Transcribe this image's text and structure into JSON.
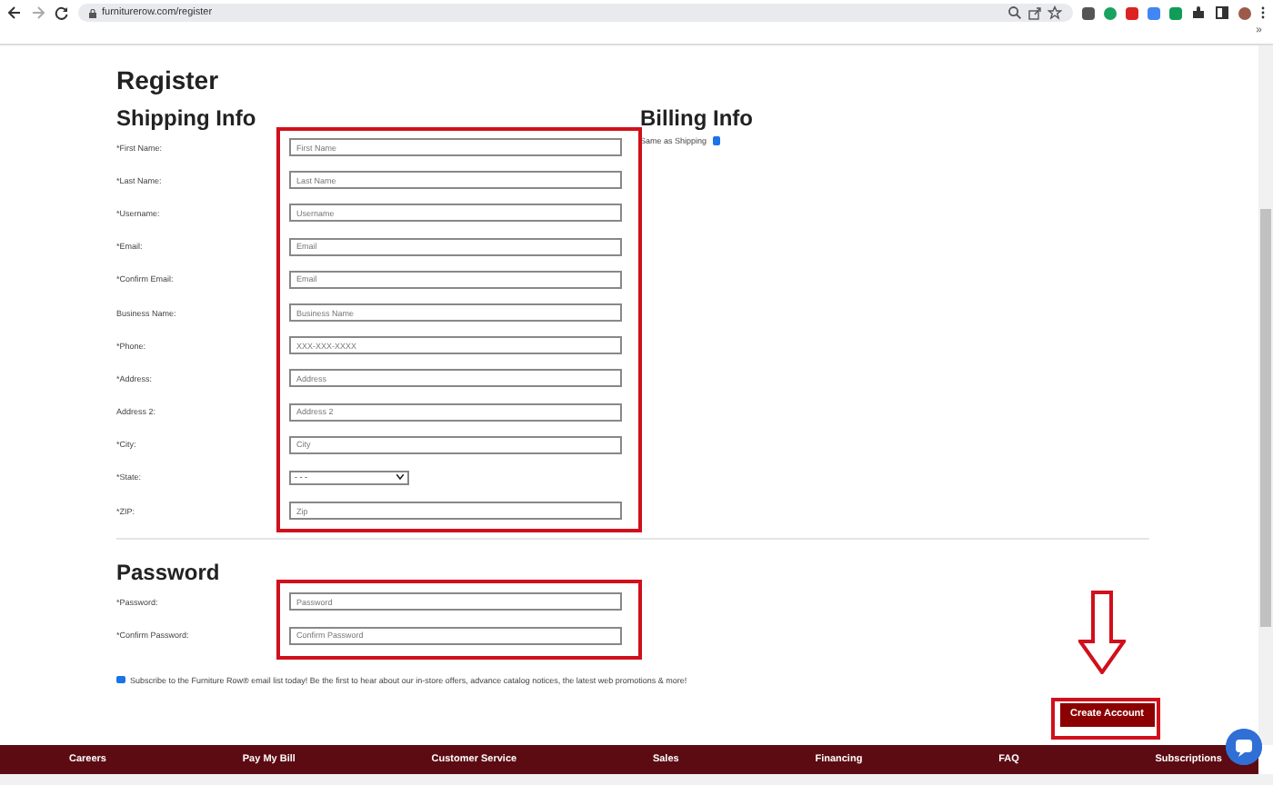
{
  "browser": {
    "url": "furniturerow.com/register",
    "overflow": "»"
  },
  "page": {
    "title": "Register",
    "shipping": {
      "heading": "Shipping Info",
      "fields": [
        {
          "kind": "text",
          "label": "*First Name:",
          "placeholder": "First Name"
        },
        {
          "kind": "text",
          "label": "*Last Name:",
          "placeholder": "Last Name"
        },
        {
          "kind": "text",
          "label": "*Username:",
          "placeholder": "Username"
        },
        {
          "kind": "text",
          "label": "*Email:",
          "placeholder": "Email"
        },
        {
          "kind": "text",
          "label": "*Confirm Email:",
          "placeholder": "Email"
        },
        {
          "kind": "text",
          "label": "Business Name:",
          "placeholder": "Business Name"
        },
        {
          "kind": "text",
          "label": "*Phone:",
          "placeholder": "XXX-XXX-XXXX"
        },
        {
          "kind": "text",
          "label": "*Address:",
          "placeholder": "Address"
        },
        {
          "kind": "text",
          "label": "Address 2:",
          "placeholder": "Address 2"
        },
        {
          "kind": "text",
          "label": "*City:",
          "placeholder": "City"
        },
        {
          "kind": "select",
          "label": "*State:",
          "value": "- - -"
        },
        {
          "kind": "text",
          "label": "*ZIP:",
          "placeholder": "Zip"
        }
      ]
    },
    "billing": {
      "heading": "Billing Info",
      "same_as_shipping": {
        "label": "Same as Shipping",
        "checked": true
      }
    },
    "password": {
      "heading": "Password",
      "fields": [
        {
          "kind": "text",
          "label": "*Password:",
          "placeholder": "Password"
        },
        {
          "kind": "text",
          "label": "*Confirm Password:",
          "placeholder": "Confirm Password"
        }
      ]
    },
    "subscribe": {
      "label": "Subscribe to the Furniture Row® email list today! Be the first to hear about our in-store offers, advance catalog notices, the latest web promotions & more!",
      "checked": true
    },
    "submit": "Create Account"
  },
  "footer": [
    "Careers",
    "Pay My Bill",
    "Customer Service",
    "Sales",
    "Financing",
    "FAQ",
    "Subscriptions"
  ]
}
